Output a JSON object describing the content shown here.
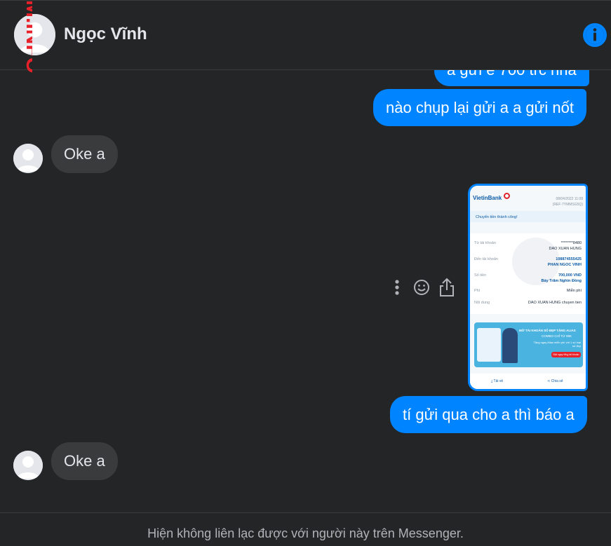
{
  "header": {
    "contact_name": "Ngọc Vĩnh",
    "info_icon": "info-icon"
  },
  "watermark": {
    "text": "M.INFO"
  },
  "messages": [
    {
      "side": "out",
      "text": "a gửi e 700 trc nha"
    },
    {
      "side": "out",
      "text": "nào chụp lại gửi a a gửi nốt"
    },
    {
      "side": "in",
      "text": "Oke a"
    },
    {
      "side": "out",
      "type": "image",
      "text": ""
    },
    {
      "side": "out",
      "text": "tí gửi qua cho a thì báo a"
    },
    {
      "side": "in",
      "text": "Oke a"
    }
  ],
  "receipt": {
    "bank": "VietinBank",
    "datetime": "08/04/2022 11:08",
    "ref": "(REF-7YMMSG5Q)",
    "status": "Chuyển tiền thành công!",
    "from_label": "Từ tài khoản",
    "from_account": "********8480",
    "from_name": "DAO XUAN HUNG",
    "to_label": "Đến tài khoản",
    "to_account": "108874555425",
    "to_name": "PHAN NGOC VINH",
    "amount_label": "Số tiền",
    "amount": "700,000 VND",
    "amount_words": "Bảy Trăm Nghìn Đồng",
    "fee_label": "Phí",
    "fee": "Miễn phí",
    "content_label": "Nội dung",
    "content": "DAO XUAN HUNG chuyen tien",
    "promo_title": "MỞ TÀI KHOẢN SỐ ĐẸP TẶNG ALIAS",
    "promo_sub": "COMBO CHỈ TỪ 99K",
    "promo_note": "Tặng ngay Alias miễn phí với 1 số loại số đẹp",
    "promo_btn": "Đặt ngay tổng tài khoản",
    "save_label": "Tải về",
    "share_label": "Chia sẻ"
  },
  "footer": {
    "text": "Hiện không liên lạc được với người này trên Messenger."
  },
  "colors": {
    "accent": "#0084ff",
    "bg": "#242526",
    "incoming": "#3a3b3c"
  }
}
